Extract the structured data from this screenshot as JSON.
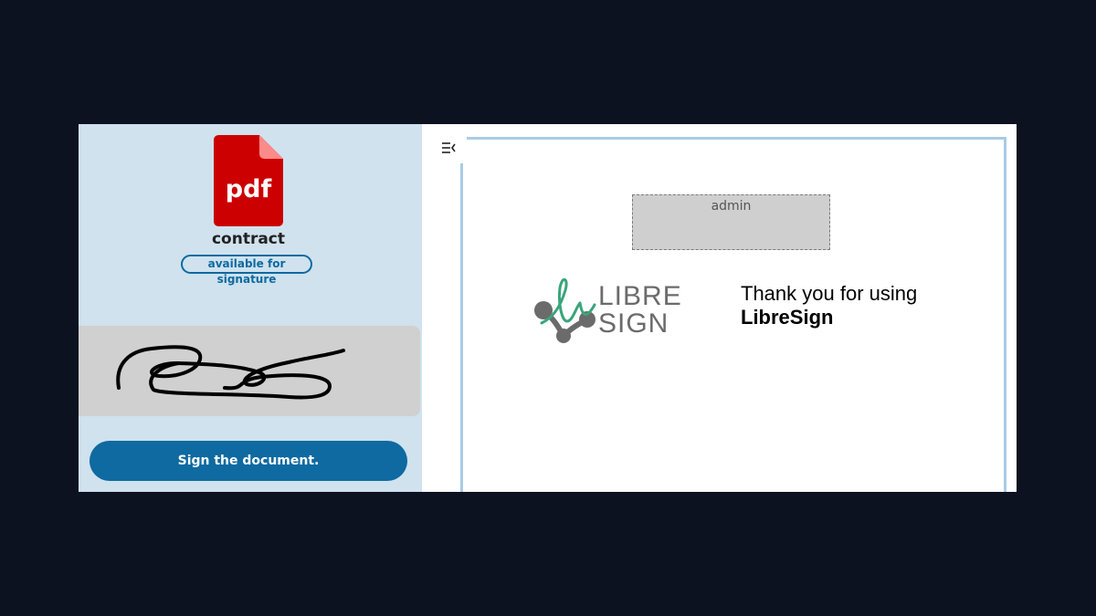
{
  "document": {
    "file_type_badge": "pdf",
    "name": "contract",
    "status": "available for signature"
  },
  "signature": {
    "description": "handwritten signature drawing"
  },
  "actions": {
    "sign_label": "Sign the document."
  },
  "preview": {
    "placeholder_user": "admin",
    "logo_line1": "LIBRE",
    "logo_line2": "SIGN",
    "thanks_line1": "Thank you for using",
    "thanks_line2": "LibreSign"
  },
  "colors": {
    "sidebar_bg": "#cfe2ee",
    "accent": "#0e6aa0",
    "pdf_red": "#cc0000",
    "page_border": "#a9cbe6",
    "logo_green": "#3aa57a",
    "logo_gray": "#6b6b6b"
  },
  "icons": {
    "file": "pdf-file-icon",
    "toggle": "sidebar-toggle-icon"
  }
}
